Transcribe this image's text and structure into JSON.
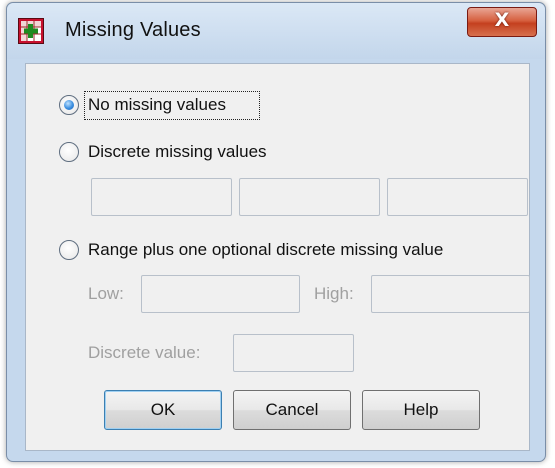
{
  "window": {
    "title": "Missing Values",
    "close_glyph": "X"
  },
  "options": {
    "no_missing": "No missing values",
    "discrete": "Discrete missing values",
    "range": "Range plus one optional discrete missing value",
    "selected": "no_missing"
  },
  "range_fields": {
    "low_label": "Low:",
    "high_label": "High:",
    "discrete_value_label": "Discrete value:"
  },
  "buttons": {
    "ok": "OK",
    "cancel": "Cancel",
    "help": "Help"
  },
  "icons": {
    "app": "spss-grid-icon",
    "close": "close-icon"
  },
  "colors": {
    "title_bg": "#c5d8ed",
    "client_bg": "#f0f0f0",
    "close_red": "#c4401f",
    "disabled_text": "#a0a0a0"
  }
}
